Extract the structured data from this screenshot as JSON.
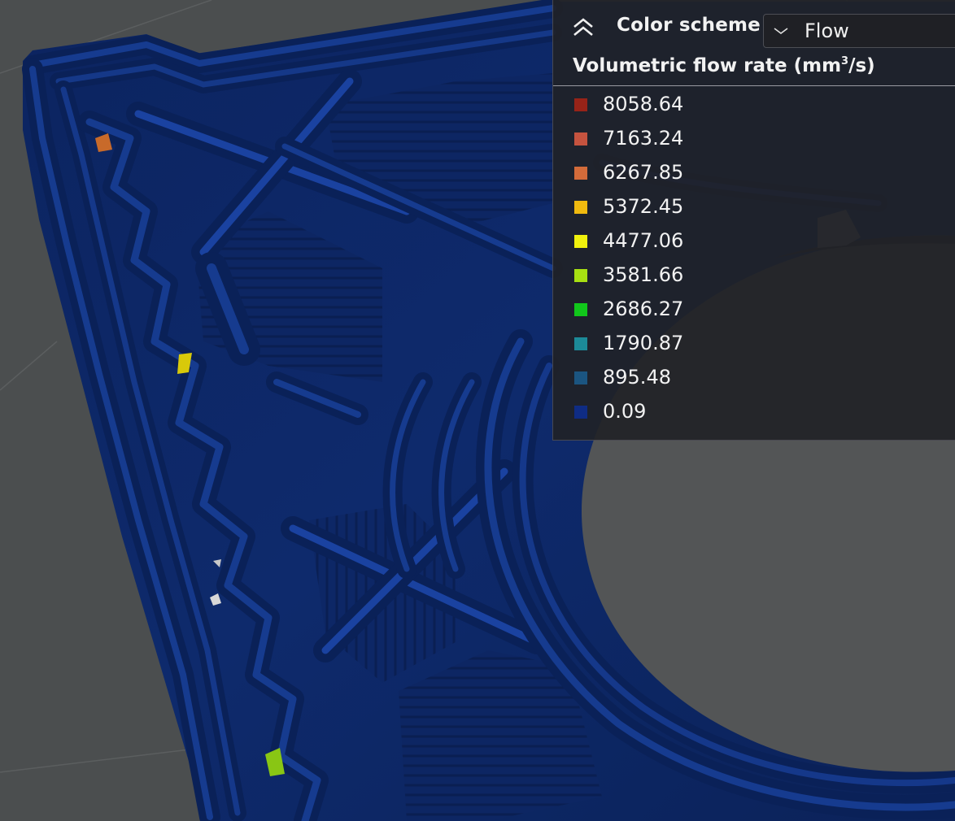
{
  "panel": {
    "header": {
      "collapse_icon": "double-chevron-up-icon",
      "title": "Color scheme",
      "select": {
        "value": "Flow",
        "icon": "chevron-down-icon"
      }
    },
    "legend": {
      "title_main": "Volumetric flow rate (mm",
      "title_sup": "3",
      "title_end": "/s)",
      "items": [
        {
          "label": "8058.64",
          "color": "#972318"
        },
        {
          "label": "7163.24",
          "color": "#c5533f"
        },
        {
          "label": "6267.85",
          "color": "#d36b3a"
        },
        {
          "label": "5372.45",
          "color": "#f0ba0f"
        },
        {
          "label": "4477.06",
          "color": "#f0f10d"
        },
        {
          "label": "3581.66",
          "color": "#a7e012"
        },
        {
          "label": "2686.27",
          "color": "#11c71b"
        },
        {
          "label": "1790.87",
          "color": "#1c8a98"
        },
        {
          "label": "895.48",
          "color": "#1b5581"
        },
        {
          "label": "0.09",
          "color": "#0f2c84"
        }
      ]
    }
  },
  "scene": {
    "background_color": "#4b4e4f",
    "grid_color": "#5a5d5e",
    "hole_color": "#535556",
    "extrusion_base_color": "#0e2868",
    "extrusion_highlight_color": "#163a8e"
  }
}
